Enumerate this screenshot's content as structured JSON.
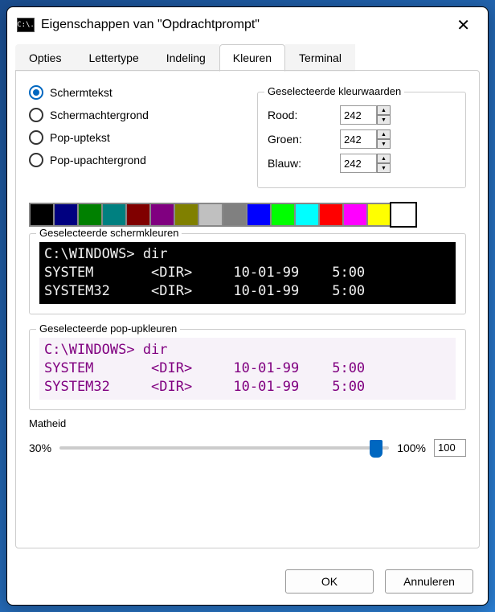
{
  "titlebar": {
    "title": "Eigenschappen van \"Opdrachtprompt\"",
    "icon_text": "C:\\."
  },
  "tabs": [
    "Opties",
    "Lettertype",
    "Indeling",
    "Kleuren",
    "Terminal"
  ],
  "active_tab": 3,
  "radios": [
    {
      "label": "Schermtekst",
      "selected": true
    },
    {
      "label": "Schermachtergrond",
      "selected": false
    },
    {
      "label": "Pop-uptekst",
      "selected": false
    },
    {
      "label": "Pop-upachtergrond",
      "selected": false
    }
  ],
  "rgb_group": {
    "title": "Geselecteerde kleurwaarden",
    "rows": [
      {
        "label": "Rood:",
        "value": "242"
      },
      {
        "label": "Groen:",
        "value": "242"
      },
      {
        "label": "Blauw:",
        "value": "242"
      }
    ]
  },
  "palette": {
    "selected": 15,
    "colors": [
      "#000000",
      "#000080",
      "#008000",
      "#008080",
      "#800000",
      "#800080",
      "#808000",
      "#c0c0c0",
      "#808080",
      "#0000ff",
      "#00ff00",
      "#00ffff",
      "#ff0000",
      "#ff00ff",
      "#ffff00",
      "#ffffff"
    ]
  },
  "screen_group": {
    "title": "Geselecteerde schermkleuren",
    "lines": "C:\\WINDOWS> dir\nSYSTEM       <DIR>     10-01-99    5:00\nSYSTEM32     <DIR>     10-01-99    5:00"
  },
  "popup_group": {
    "title": "Geselecteerde pop-upkleuren",
    "lines": "C:\\WINDOWS> dir\nSYSTEM       <DIR>     10-01-99    5:00\nSYSTEM32     <DIR>     10-01-99    5:00"
  },
  "opacity": {
    "title": "Matheid",
    "min_label": "30%",
    "max_label": "100%",
    "value": "100",
    "thumb_pct": 96
  },
  "buttons": {
    "ok": "OK",
    "cancel": "Annuleren"
  }
}
